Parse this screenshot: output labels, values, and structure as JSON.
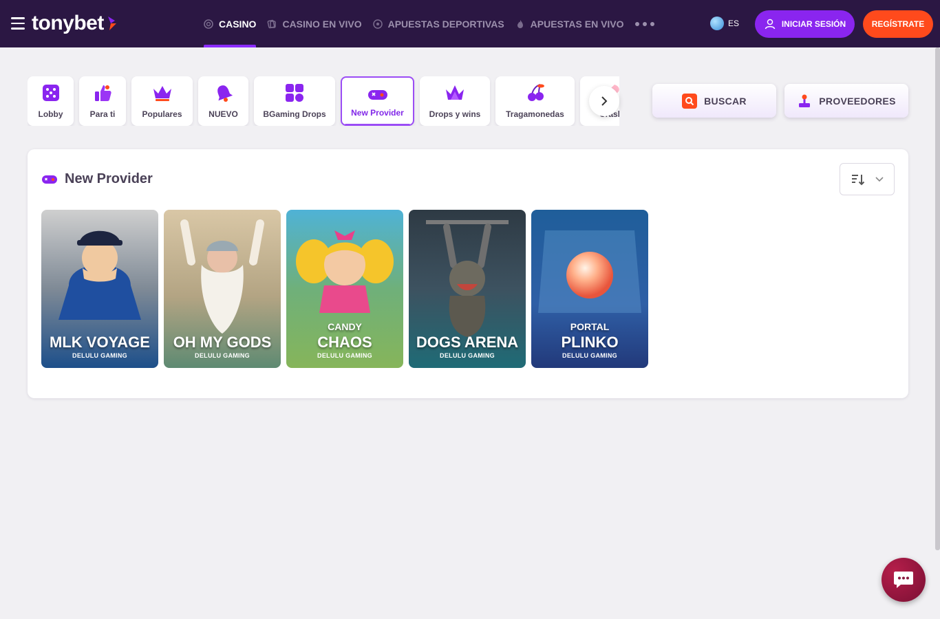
{
  "header": {
    "logo_text": "tonybet",
    "nav": [
      {
        "label": "CASINO",
        "icon": "casino-chip-icon",
        "active": true
      },
      {
        "label": "CASINO EN VIVO",
        "icon": "cards-icon",
        "active": false
      },
      {
        "label": "APUESTAS DEPORTIVAS",
        "icon": "soccer-ball-icon",
        "active": false
      },
      {
        "label": "APUESTAS EN VIVO",
        "icon": "flame-icon",
        "active": false
      }
    ],
    "language": "ES",
    "login_label": "INICIAR SESIÓN",
    "register_label": "REGÍSTRATE"
  },
  "categories": [
    {
      "label": "Lobby",
      "icon": "dice-icon"
    },
    {
      "label": "Para ti",
      "icon": "thumbs-up-icon"
    },
    {
      "label": "Populares",
      "icon": "crown-icon"
    },
    {
      "label": "NUEVO",
      "icon": "bell-icon"
    },
    {
      "label": "BGaming Drops",
      "icon": "grid-icon"
    },
    {
      "label": "New Provider",
      "icon": "gamepad-icon",
      "active": true
    },
    {
      "label": "Drops y wins",
      "icon": "crown-icon"
    },
    {
      "label": "Tragamonedas",
      "icon": "cherries-icon"
    },
    {
      "label": "Crash",
      "icon": "rocket-icon"
    }
  ],
  "actions": {
    "search_label": "BUSCAR",
    "providers_label": "PROVEEDORES"
  },
  "section": {
    "title": "New Provider"
  },
  "games": [
    {
      "prefix": "",
      "name": "MLK VOYAGE",
      "provider": "DELULU GAMING"
    },
    {
      "prefix": "",
      "name": "OH MY GODS",
      "provider": "DELULU GAMING"
    },
    {
      "prefix": "CANDY",
      "name": "CHAOS",
      "provider": "DELULU GAMING"
    },
    {
      "prefix": "",
      "name": "DOGS ARENA",
      "provider": "DELULU GAMING"
    },
    {
      "prefix": "PORTAL",
      "name": "PLINKO",
      "provider": "DELULU GAMING"
    }
  ],
  "colors": {
    "header_bg": "#2b1743",
    "accent_purple": "#8a25ef",
    "accent_orange": "#ff4a1c"
  }
}
